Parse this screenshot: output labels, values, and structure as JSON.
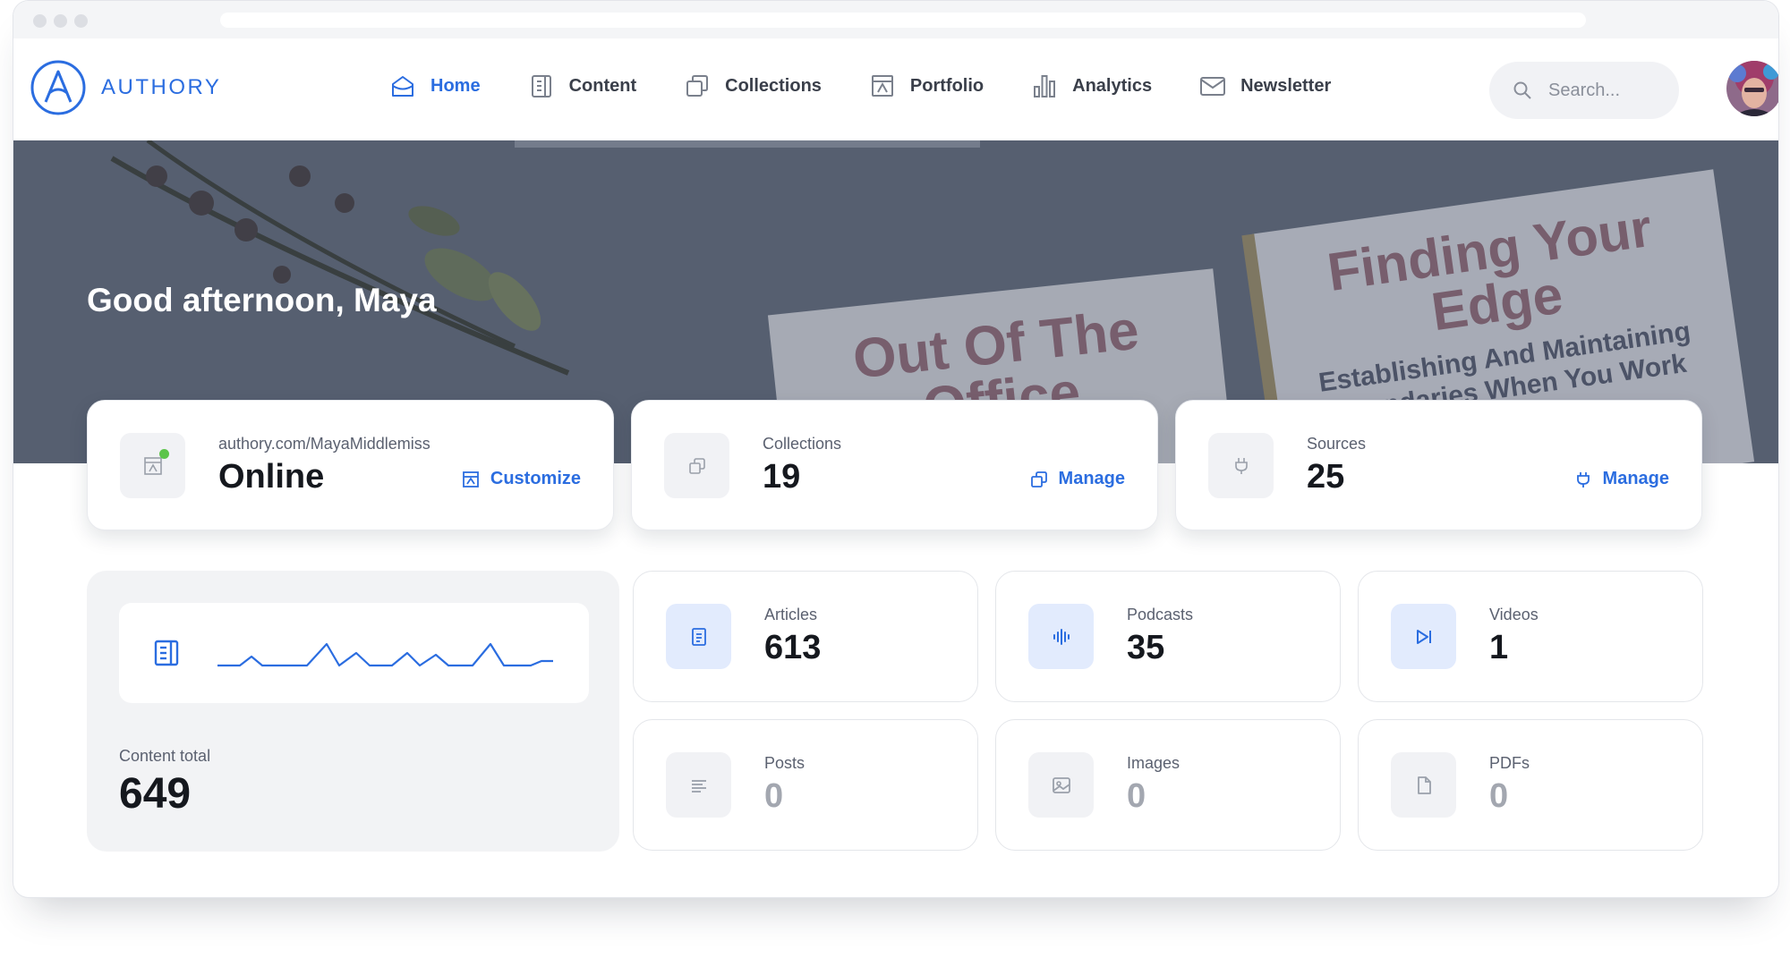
{
  "brand": {
    "name": "AUTHORY"
  },
  "nav": {
    "items": [
      {
        "label": "Home",
        "icon": "home-icon",
        "active": true
      },
      {
        "label": "Content",
        "icon": "content-icon",
        "active": false
      },
      {
        "label": "Collections",
        "icon": "collections-icon",
        "active": false
      },
      {
        "label": "Portfolio",
        "icon": "portfolio-icon",
        "active": false
      },
      {
        "label": "Analytics",
        "icon": "analytics-icon",
        "active": false
      },
      {
        "label": "Newsletter",
        "icon": "envelope-icon",
        "active": false
      }
    ],
    "search": {
      "placeholder": "Search..."
    }
  },
  "hero": {
    "greeting": "Good afternoon, Maya"
  },
  "summary_cards": {
    "portfolio": {
      "label": "authory.com/MayaMiddlemiss",
      "value": "Online",
      "action": "Customize",
      "status": "online"
    },
    "collections": {
      "label": "Collections",
      "value": "19",
      "action": "Manage"
    },
    "sources": {
      "label": "Sources",
      "value": "25",
      "action": "Manage"
    }
  },
  "content_total": {
    "label": "Content total",
    "value": "649"
  },
  "content_types": [
    {
      "label": "Articles",
      "value": "613",
      "icon": "article-icon"
    },
    {
      "label": "Podcasts",
      "value": "35",
      "icon": "audio-wave-icon"
    },
    {
      "label": "Videos",
      "value": "1",
      "icon": "video-icon"
    },
    {
      "label": "Posts",
      "value": "0",
      "icon": "post-icon"
    },
    {
      "label": "Images",
      "value": "0",
      "icon": "image-icon"
    },
    {
      "label": "PDFs",
      "value": "0",
      "icon": "pdf-icon"
    }
  ],
  "colors": {
    "accent": "#2b6de0",
    "online": "#5cc44a",
    "muted": "#a3a7b0"
  }
}
